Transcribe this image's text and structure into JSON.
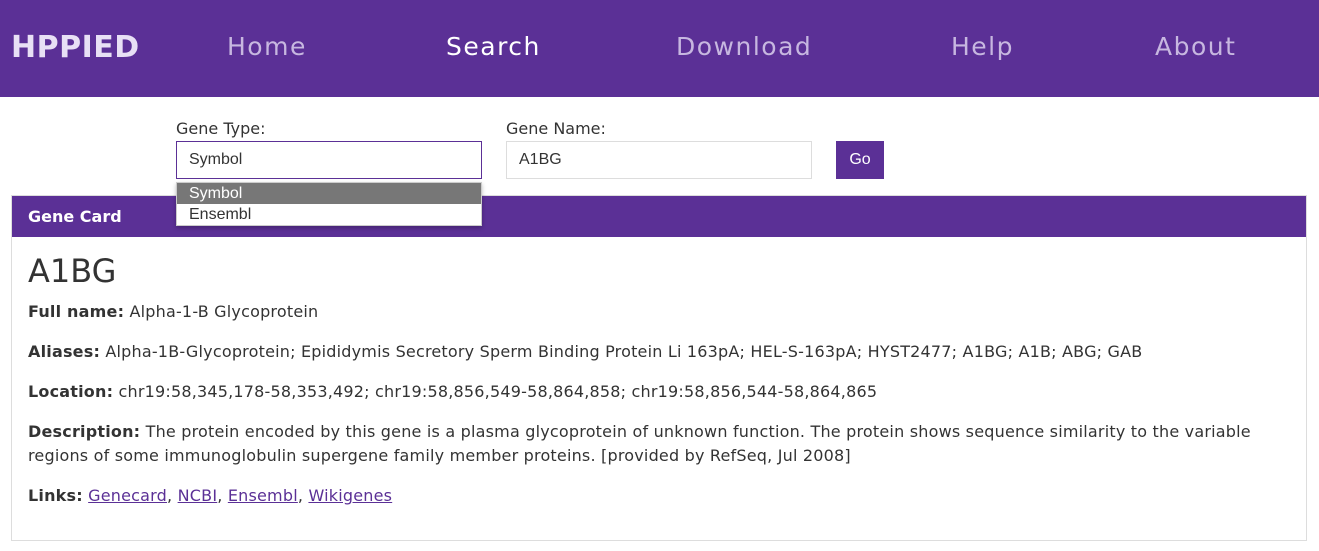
{
  "navbar": {
    "brand": "HPPIED",
    "links": [
      "Home",
      "Search",
      "Download",
      "Help",
      "About"
    ],
    "active": "Search"
  },
  "search": {
    "gene_type_label": "Gene Type:",
    "gene_type_value": "Symbol",
    "gene_type_options": [
      "Symbol",
      "Ensembl"
    ],
    "gene_name_label": "Gene Name:",
    "gene_name_value": "A1BG",
    "go_label": "Go"
  },
  "card": {
    "header": "Gene Card",
    "gene_symbol": "A1BG",
    "full_name_label": "Full name:",
    "full_name": "Alpha-1-B Glycoprotein",
    "aliases_label": "Aliases:",
    "aliases": "Alpha-1B-Glycoprotein; Epididymis Secretory Sperm Binding Protein Li 163pA; HEL-S-163pA; HYST2477; A1BG; A1B; ABG; GAB",
    "location_label": "Location:",
    "location": "chr19:58,345,178-58,353,492; chr19:58,856,549-58,864,858; chr19:58,856,544-58,864,865",
    "description_label": "Description:",
    "description": "The protein encoded by this gene is a plasma glycoprotein of unknown function. The protein shows sequence similarity to the variable regions of some immunoglobulin supergene family member proteins. [provided by RefSeq, Jul 2008]",
    "links_label": "Links:",
    "links": [
      "Genecard",
      "NCBI",
      "Ensembl",
      "Wikigenes"
    ]
  },
  "colors": {
    "brand_purple": "#5b3096",
    "dropdown_selected": "#777777"
  }
}
